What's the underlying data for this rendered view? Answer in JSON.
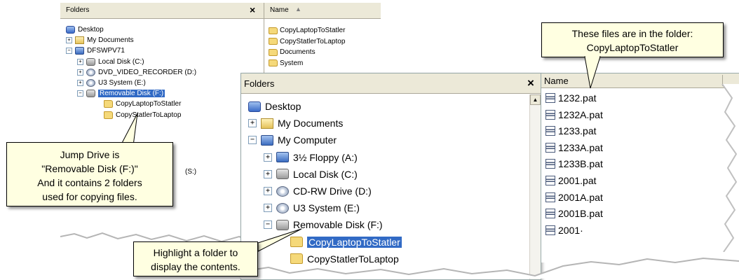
{
  "back_window": {
    "folders_header": "Folders",
    "close_glyph": "×",
    "name_header": "Name",
    "tree": [
      {
        "label": "Desktop",
        "expander": "",
        "icon": "desktop-icon",
        "selected": false
      },
      {
        "label": "My Documents",
        "expander": "+",
        "icon": "my-documents-icon",
        "selected": false
      },
      {
        "label": "DFSWPV71",
        "expander": "−",
        "icon": "computer-icon",
        "selected": false
      },
      {
        "label": "Local Disk (C:)",
        "expander": "+",
        "icon": "drive-icon",
        "selected": false
      },
      {
        "label": "DVD_VIDEO_RECORDER (D:)",
        "expander": "+",
        "icon": "dvd-icon",
        "selected": false
      },
      {
        "label": "U3 System (E:)",
        "expander": "+",
        "icon": "cd-icon",
        "selected": false
      },
      {
        "label": "Removable Disk (F:)",
        "expander": "−",
        "icon": "removable-disk-icon",
        "selected": true
      },
      {
        "label": "CopyLaptopToStatler",
        "expander": "",
        "icon": "folder-icon",
        "selected": false
      },
      {
        "label": "CopyStatlerToLaptop",
        "expander": "",
        "icon": "folder-icon",
        "selected": false
      }
    ],
    "partial_label": "(S:)",
    "files": [
      "CopyLaptopToStatler",
      "CopyStatlerToLaptop",
      "Documents",
      "System"
    ]
  },
  "front_window": {
    "folders_header": "Folders",
    "close_glyph": "×",
    "tree": [
      {
        "label": "Desktop",
        "expander": "",
        "icon": "desktop-icon",
        "selected": false
      },
      {
        "label": "My Documents",
        "expander": "+",
        "icon": "my-documents-icon",
        "selected": false
      },
      {
        "label": "My Computer",
        "expander": "−",
        "icon": "computer-icon",
        "selected": false
      },
      {
        "label": "3½ Floppy (A:)",
        "expander": "+",
        "icon": "floppy-icon",
        "selected": false
      },
      {
        "label": "Local Disk (C:)",
        "expander": "+",
        "icon": "drive-icon",
        "selected": false
      },
      {
        "label": "CD-RW Drive (D:)",
        "expander": "+",
        "icon": "cd-drive-icon",
        "selected": false
      },
      {
        "label": "U3 System (E:)",
        "expander": "+",
        "icon": "cd-icon",
        "selected": false
      },
      {
        "label": "Removable Disk (F:)",
        "expander": "−",
        "icon": "removable-disk-icon",
        "selected": false
      },
      {
        "label": "CopyLaptopToStatler",
        "expander": "",
        "icon": "folder-icon",
        "selected": true
      },
      {
        "label": "CopyStatlerToLaptop",
        "expander": "",
        "icon": "folder-icon",
        "selected": false
      }
    ]
  },
  "file_list": {
    "name_header": "Name",
    "files": [
      "1232.pat",
      "1232A.pat",
      "1233.pat",
      "1233A.pat",
      "1233B.pat",
      "2001.pat",
      "2001A.pat",
      "2001B.pat",
      "2001·"
    ]
  },
  "callouts": {
    "jump_drive": [
      "Jump Drive is",
      "\"Removable Disk (F:)\"",
      "And it contains 2 folders",
      "used for copying files."
    ],
    "files_in_folder": [
      "These files are in the folder:",
      "CopyLaptopToStatler"
    ],
    "highlight": [
      "Highlight a folder to",
      "display the contents."
    ]
  },
  "colors": {
    "selection": "#316ac5",
    "callout_background": "#ffffe1",
    "header_background": "#ece9d8"
  }
}
